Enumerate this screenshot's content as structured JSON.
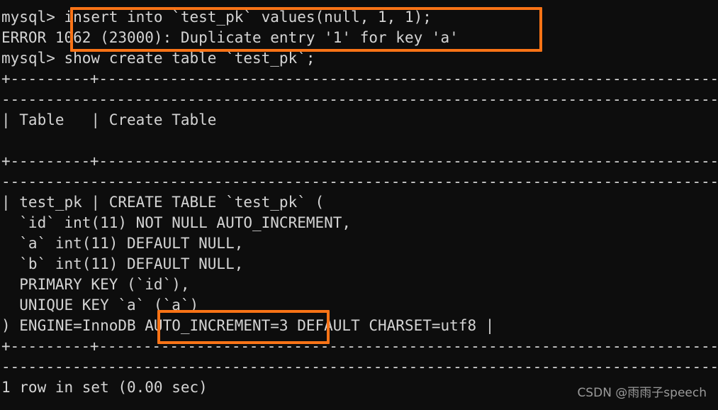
{
  "terminal": {
    "prompt": "mysql>",
    "background_color": "#0d0d0d",
    "text_color": "#d4d4d4",
    "highlight_color": "#f97316",
    "lines": [
      "mysql> insert into `test_pk` values(null, 1, 1);",
      "ERROR 1062 (23000): Duplicate entry '1' for key 'a'",
      "mysql> show create table `test_pk`;",
      "+---------+-----------------------------------------------------------------------",
      "-----------------------------------------------------------------------------------",
      "| Table   | Create Table",
      "",
      "+---------+-----------------------------------------------------------------------",
      "-----------------------------------------------------------------------------------",
      "| test_pk | CREATE TABLE `test_pk` (",
      "  `id` int(11) NOT NULL AUTO_INCREMENT,",
      "  `a` int(11) DEFAULT NULL,",
      "  `b` int(11) DEFAULT NULL,",
      "  PRIMARY KEY (`id`),",
      "  UNIQUE KEY `a` (`a`)",
      ") ENGINE=InnoDB AUTO_INCREMENT=3 DEFAULT CHARSET=utf8 |",
      "+---------+-----------------------------------------------------------------------",
      "-----------------------------------------------------------------------------------",
      "1 row in set (0.00 sec)"
    ]
  },
  "commands": {
    "insert_statement": "insert into `test_pk` values(null, 1, 1);",
    "error_message": "ERROR 1062 (23000): Duplicate entry '1' for key 'a'",
    "show_create_statement": "show create table `test_pk`;",
    "result_footer": "1 row in set (0.00 sec)"
  },
  "result_table": {
    "columns": [
      "Table",
      "Create Table"
    ],
    "row": {
      "table_name": "test_pk",
      "create_table": [
        "CREATE TABLE `test_pk` (",
        "  `id` int(11) NOT NULL AUTO_INCREMENT,",
        "  `a` int(11) DEFAULT NULL,",
        "  `b` int(11) DEFAULT NULL,",
        "  PRIMARY KEY (`id`),",
        "  UNIQUE KEY `a` (`a`)",
        ") ENGINE=InnoDB AUTO_INCREMENT=3 DEFAULT CHARSET=utf8"
      ]
    }
  },
  "annotations": {
    "error_highlight_text": "insert into `test_pk` values(null, 1, 1); / ERROR 1062 (23000): Duplicate entry '1' for key 'a'",
    "auto_increment_highlight_text": "AUTO_INCREMENT=3"
  },
  "watermark": {
    "text": "CSDN @雨雨子speech"
  }
}
